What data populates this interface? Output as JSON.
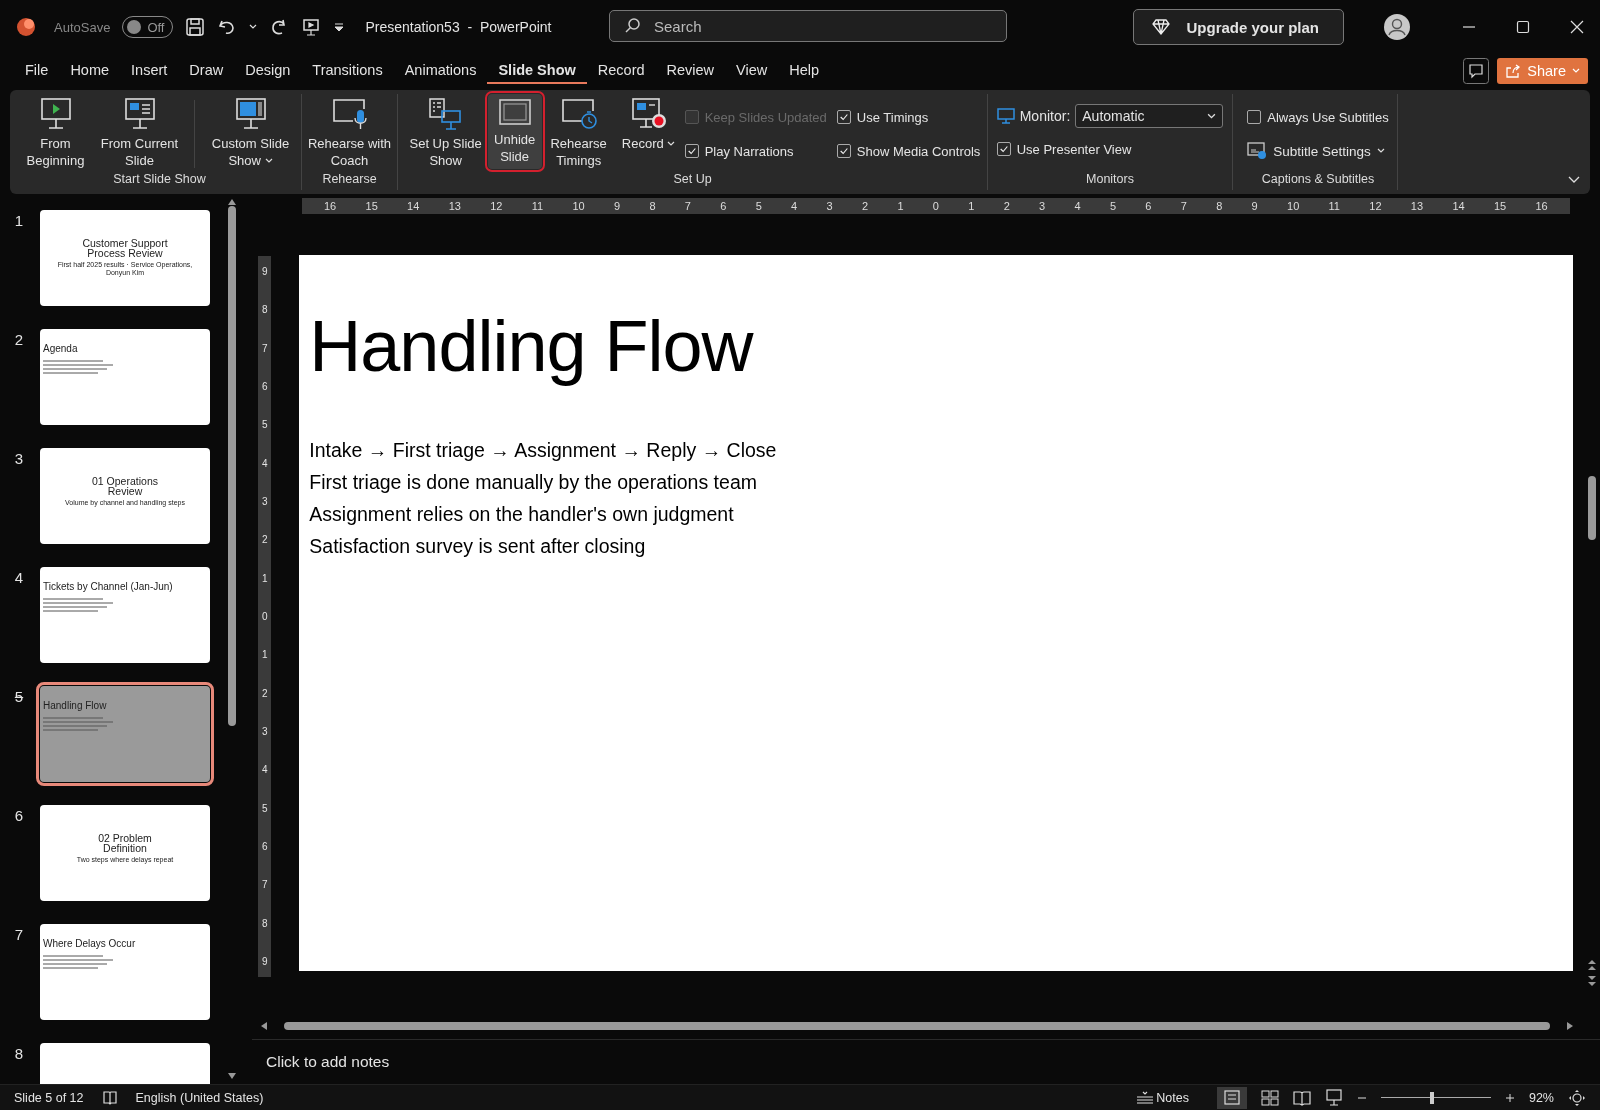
{
  "window": {
    "title": "Presentation53  -  PowerPoint",
    "autosave": {
      "label": "AutoSave",
      "state": "Off",
      "on": false
    },
    "search": {
      "placeholder": "Search"
    },
    "upgrade": "Upgrade your plan"
  },
  "tabs": [
    {
      "label": "File",
      "selected": false
    },
    {
      "label": "Home",
      "selected": false
    },
    {
      "label": "Insert",
      "selected": false
    },
    {
      "label": "Draw",
      "selected": false
    },
    {
      "label": "Design",
      "selected": false
    },
    {
      "label": "Transitions",
      "selected": false
    },
    {
      "label": "Animations",
      "selected": false
    },
    {
      "label": "Slide Show",
      "selected": true
    },
    {
      "label": "Record",
      "selected": false
    },
    {
      "label": "Review",
      "selected": false
    },
    {
      "label": "View",
      "selected": false
    },
    {
      "label": "Help",
      "selected": false
    }
  ],
  "share": "Share",
  "ribbon": {
    "groups": [
      {
        "label": "Start Slide Show",
        "buttons": [
          {
            "label": "From Beginning",
            "dropdown": false,
            "highlighted": false
          },
          {
            "label": "From Current Slide",
            "dropdown": false,
            "highlighted": false
          },
          {
            "label": "Custom Slide Show",
            "dropdown": true,
            "highlighted": false
          }
        ]
      },
      {
        "label": "Rehearse",
        "buttons": [
          {
            "label": "Rehearse with Coach",
            "dropdown": false,
            "highlighted": false
          }
        ]
      },
      {
        "label": "Set Up",
        "buttons": [
          {
            "label": "Set Up Slide Show",
            "dropdown": false,
            "highlighted": false
          },
          {
            "label": "Unhide Slide",
            "dropdown": false,
            "highlighted": true
          },
          {
            "label": "Rehearse Timings",
            "dropdown": false,
            "highlighted": false
          },
          {
            "label": "Record",
            "dropdown": true,
            "highlighted": false
          }
        ],
        "checkboxes": [
          {
            "label": "Keep Slides Updated",
            "checked": false,
            "disabled": true
          },
          {
            "label": "Play Narrations",
            "checked": true,
            "disabled": false
          },
          {
            "label": "Use Timings",
            "checked": true,
            "disabled": false
          },
          {
            "label": "Show Media Controls",
            "checked": true,
            "disabled": false
          }
        ]
      },
      {
        "label": "Monitors",
        "monitor": {
          "label": "Monitor:",
          "value": "Automatic"
        },
        "checkboxes": [
          {
            "label": "Use Presenter View",
            "checked": true,
            "disabled": false
          }
        ]
      },
      {
        "label": "Captions & Subtitles",
        "checkboxes": [
          {
            "label": "Always Use Subtitles",
            "checked": false,
            "disabled": false
          }
        ],
        "subtitle_settings": "Subtitle Settings"
      }
    ]
  },
  "slides": [
    {
      "number": "1",
      "kind": "title",
      "title": "Customer Support Process Review",
      "subtitle": "First half 2025 results · Service Operations, Donyun Kim",
      "selected": false,
      "hidden": false
    },
    {
      "number": "2",
      "kind": "content",
      "title": "Agenda",
      "selected": false,
      "hidden": false
    },
    {
      "number": "3",
      "kind": "title",
      "title": "01 Operations Review",
      "subtitle": "Volume by channel and handling steps",
      "selected": false,
      "hidden": false
    },
    {
      "number": "4",
      "kind": "content",
      "title": "Tickets by Channel (Jan-Jun)",
      "selected": false,
      "hidden": false
    },
    {
      "number": "5",
      "kind": "content",
      "title": "Handling Flow",
      "selected": true,
      "hidden": true
    },
    {
      "number": "6",
      "kind": "title",
      "title": "02 Problem Definition",
      "subtitle": "Two steps where delays repeat",
      "selected": false,
      "hidden": false
    },
    {
      "number": "7",
      "kind": "content",
      "title": "Where Delays Occur",
      "selected": false,
      "hidden": false
    },
    {
      "number": "8",
      "kind": "blank",
      "selected": false,
      "hidden": false
    }
  ],
  "ruler": {
    "horizontal": [
      "16",
      "15",
      "14",
      "13",
      "12",
      "11",
      "10",
      "9",
      "8",
      "7",
      "6",
      "5",
      "4",
      "3",
      "2",
      "1",
      "0",
      "1",
      "2",
      "3",
      "4",
      "5",
      "6",
      "7",
      "8",
      "9",
      "10",
      "11",
      "12",
      "13",
      "14",
      "15",
      "16"
    ],
    "vertical": [
      "9",
      "8",
      "7",
      "6",
      "5",
      "4",
      "3",
      "2",
      "1",
      "0",
      "1",
      "2",
      "3",
      "4",
      "5",
      "6",
      "7",
      "8",
      "9"
    ]
  },
  "slide": {
    "title": "Handling Flow",
    "lines": [
      "Intake → First triage → Assignment → Reply → Close",
      "First triage is done manually by the operations team",
      "Assignment relies on the handler's own judgment",
      "Satisfaction survey is sent after closing"
    ]
  },
  "notes": {
    "placeholder": "Click to add notes"
  },
  "status_bar": {
    "slide": "Slide 5 of 12",
    "language": "English (United States)",
    "notes": "Notes",
    "zoom": {
      "level": 0.46,
      "reading": "92%"
    }
  }
}
